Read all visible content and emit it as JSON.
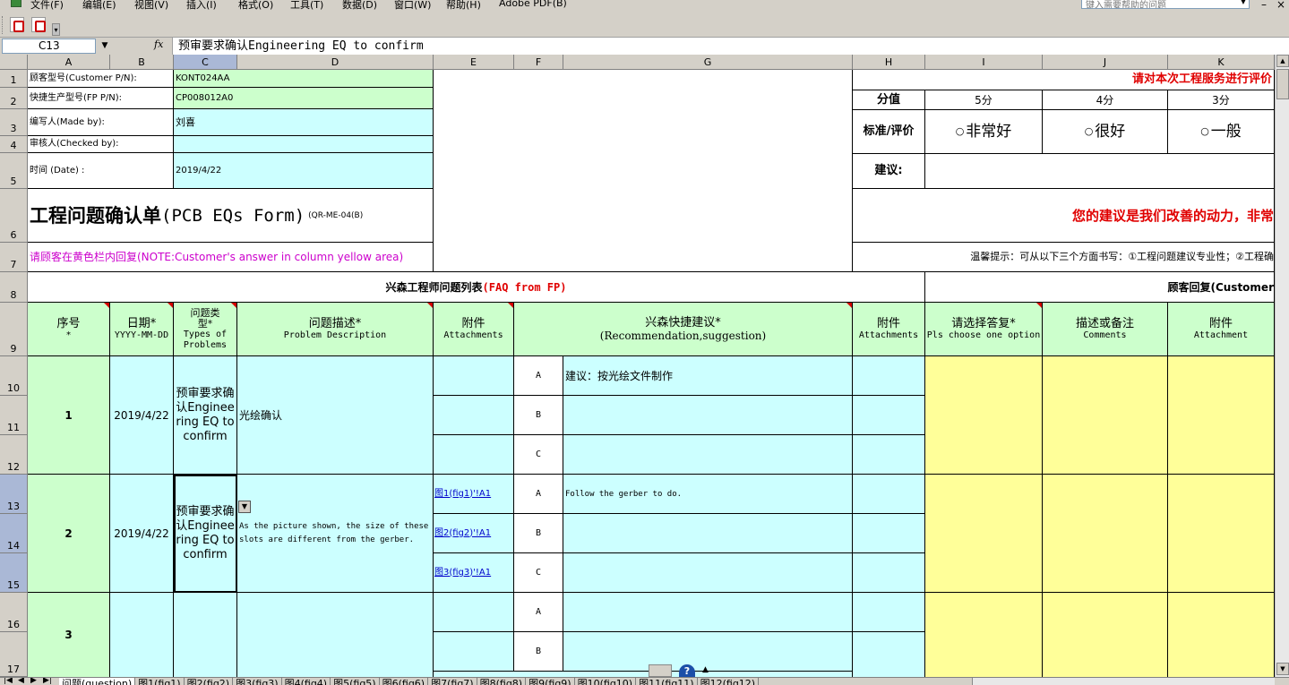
{
  "menu": {
    "items": [
      "文件(F)",
      "编辑(E)",
      "视图(V)",
      "插入(I)",
      "格式(O)",
      "工具(T)",
      "数据(D)",
      "窗口(W)",
      "帮助(H)",
      "Adobe PDF(B)"
    ],
    "help_placeholder": "键入需要帮助的问题"
  },
  "formula": {
    "cell_ref": "C13",
    "fx": "fx",
    "value": "预审要求确认Engineering EQ to confirm"
  },
  "columns": [
    "A",
    "B",
    "C",
    "D",
    "E",
    "F",
    "G",
    "H",
    "I",
    "J",
    "K"
  ],
  "rows": [
    "1",
    "2",
    "3",
    "4",
    "5",
    "6",
    "7",
    "8",
    "9",
    "10",
    "11",
    "12",
    "13",
    "14",
    "15",
    "16",
    "17"
  ],
  "header_info": {
    "customer_pn_label": "顾客型号(Customer P/N):",
    "customer_pn_value": "KONT024AA",
    "fp_pn_label": "快捷生产型号(FP P/N):",
    "fp_pn_value": "CP008012A0",
    "made_by_label": "编写人(Made by):",
    "made_by_value": "刘喜",
    "checked_by_label": "审核人(Checked by):",
    "checked_by_value": "",
    "date_label": "时间 (Date) :",
    "date_value": "2019/4/22",
    "form_title": "工程问题确认单",
    "form_title_en": "(PCB EQs Form)",
    "form_code": "(QR-ME-04(B)",
    "note": "请顾客在黄色栏内回复(NOTE:Customer's answer in column yellow area)"
  },
  "rating": {
    "title": "请对本次工程服务进行评价",
    "score_label": "分值",
    "scores": [
      "5分",
      "4分",
      "3分"
    ],
    "criteria_label": "标准/评价",
    "options": [
      "非常好",
      "很好",
      "一般"
    ],
    "suggestion_label": "建议:",
    "motto": "您的建议是我们改善的动力，非常",
    "tip": "温馨提示：可从以下三个方面书写：①工程问题建议专业性；②工程确"
  },
  "section": {
    "fp_title": "兴森工程师问题列表",
    "fp_title_en": "(FAQ from FP)",
    "customer_title": "顾客回复(Customer"
  },
  "table_headers": {
    "seq": "序号",
    "seq_sub": "*",
    "date": "日期*",
    "date_sub": "YYYY-MM-DD",
    "type": "问题类型*",
    "type_sub": "Types of Problems",
    "desc": "问题描述*",
    "desc_sub": "Problem Description",
    "attach": "附件",
    "attach_sub": "Attachments",
    "recommend": "兴森快捷建议*",
    "recommend_sub": "(Recommendation,suggestion)",
    "attach2": "附件",
    "attach2_sub": "Attachments",
    "choose": "请选择答复*",
    "choose_sub": "Pls choose one option",
    "comments": "描述或备注",
    "comments_sub": "Comments",
    "attach3": "附件",
    "attach3_sub": "Attachment"
  },
  "items": [
    {
      "seq": "1",
      "date": "2019/4/22",
      "type": "预审要求确认Engineering EQ to confirm",
      "desc": "光绘确认",
      "links": [
        "",
        "",
        ""
      ],
      "options": [
        {
          "key": "A",
          "text": "建议：按光绘文件制作"
        },
        {
          "key": "B",
          "text": ""
        },
        {
          "key": "C",
          "text": ""
        }
      ]
    },
    {
      "seq": "2",
      "date": "2019/4/22",
      "type": "预审要求确认Engineering EQ to confirm",
      "desc": "As the picture shown, the size of these slots are different from the gerber.",
      "links": [
        "图1(fig1)'!A1",
        "图2(fig2)'!A1",
        "图3(fig3)'!A1"
      ],
      "options": [
        {
          "key": "A",
          "text": "Follow the gerber to do."
        },
        {
          "key": "B",
          "text": ""
        },
        {
          "key": "C",
          "text": ""
        }
      ]
    },
    {
      "seq": "3",
      "date": "",
      "type": "",
      "desc": "",
      "links": [
        "",
        ""
      ],
      "options": [
        {
          "key": "A",
          "text": ""
        },
        {
          "key": "B",
          "text": ""
        }
      ]
    }
  ],
  "sheet_tabs": [
    "问题(question)",
    "图1(fig1)",
    "图2(fig2)",
    "图3(fig3)",
    "图4(fig4)",
    "图5(fig5)",
    "图6(fig6)",
    "图7(fig7)",
    "图8(fig8)",
    "图9(fig9)",
    "图10(fig10)",
    "图11(fig11)",
    "图12(fig12)"
  ],
  "colors": {
    "green": "#ccffcc",
    "cyan": "#ccffff",
    "yellow": "#ffff99",
    "red": "#e00000",
    "magenta": "#cc00cc",
    "selection": "#aab8d6"
  }
}
